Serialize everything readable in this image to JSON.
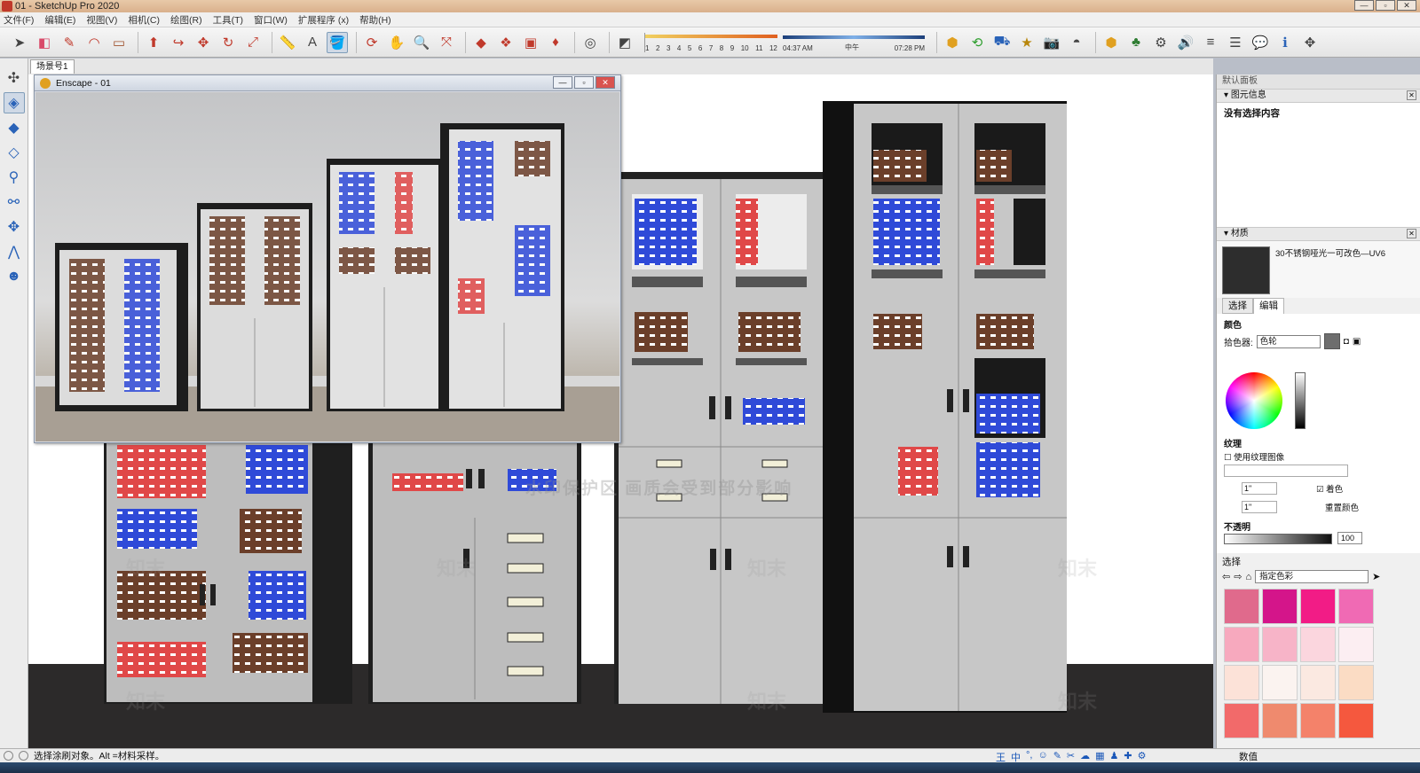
{
  "window": {
    "title": "01 - SketchUp Pro 2020",
    "min": "—",
    "max": "▫",
    "close": "✕"
  },
  "menu": [
    "文件(F)",
    "编辑(E)",
    "视图(V)",
    "相机(C)",
    "绘图(R)",
    "工具(T)",
    "窗口(W)",
    "扩展程序 (x)",
    "帮助(H)"
  ],
  "toolbar": {
    "ruler_numbers": [
      "1",
      "2",
      "3",
      "4",
      "5",
      "6",
      "7",
      "8",
      "9",
      "10",
      "11",
      "12"
    ],
    "time_start": "04:37 AM",
    "time_mid": "中午",
    "time_end": "07:28 PM"
  },
  "scene_tab": "场景号1",
  "enscape": {
    "title": "Enscape - 01"
  },
  "viewport": {
    "watermark": "水印保护区  画质会受到部分影响",
    "watermark_tile": "知末"
  },
  "right_panel": {
    "title": "默认面板",
    "entity_info": {
      "header": "图元信息",
      "body": "没有选择内容"
    },
    "materials": {
      "header": "材质",
      "name": "30不锈钢哑光一可改色—UV6",
      "tabs": [
        "选择",
        "编辑"
      ],
      "color_label": "颜色",
      "picker_label": "拾色器:",
      "picker_value": "色轮",
      "texture_label": "纹理",
      "use_texture": "使用纹理图像",
      "width": "1\"",
      "height": "1\"",
      "colorize": "着色",
      "reset_color": "重置颜色",
      "opacity_label": "不透明",
      "opacity_value": "100"
    },
    "select": {
      "label": "选择",
      "dropdown": "指定色彩",
      "swatches": [
        "#e06a8c",
        "#d4158a",
        "#f21c86",
        "#f06ab4",
        "#f7a9be",
        "#f7b4c8",
        "#fbd6de",
        "#fceef2",
        "#fce2d8",
        "#fbf3f0",
        "#fbe9e1",
        "#fbdcc4",
        "#f26a6a",
        "#ef8a6e",
        "#f4826a",
        "#f5583e"
      ]
    }
  },
  "status": {
    "message": "选择涂刷对象。Alt =材料采样。",
    "value_label": "数值",
    "ime_icons": [
      "王",
      "中",
      "°,",
      "☺",
      "✎",
      "✂",
      "☁",
      "▦",
      "♟",
      "✚",
      "⚙"
    ]
  }
}
